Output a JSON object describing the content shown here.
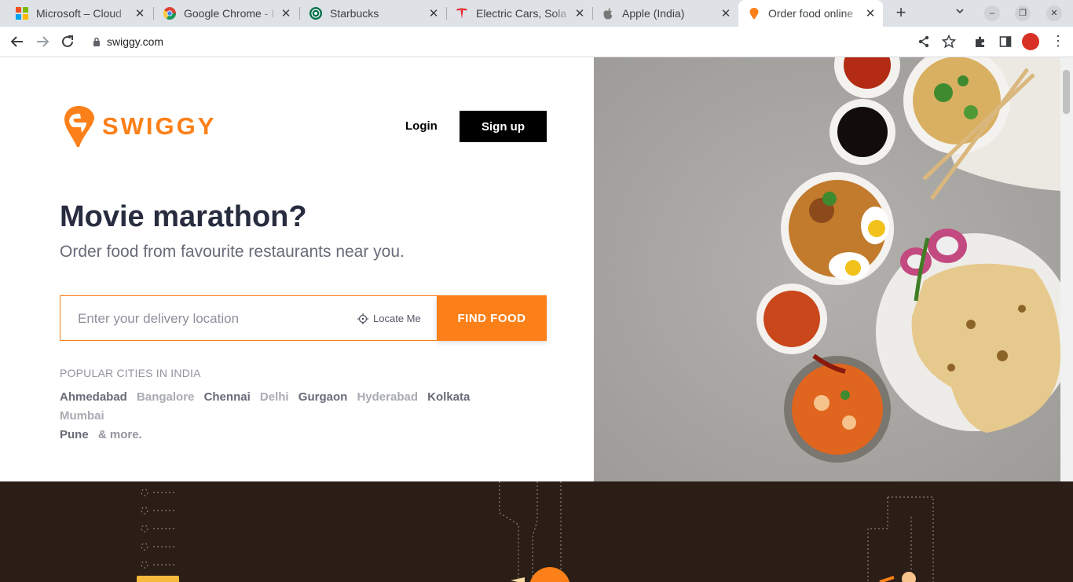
{
  "browser": {
    "tabs": [
      {
        "title": "Microsoft – Cloud",
        "icon": "microsoft-icon",
        "active": false
      },
      {
        "title": "Google Chrome - I",
        "icon": "chrome-icon",
        "active": false
      },
      {
        "title": "Starbucks",
        "icon": "starbucks-icon",
        "active": false
      },
      {
        "title": "Electric Cars, Sola",
        "icon": "tesla-icon",
        "active": false
      },
      {
        "title": "Apple (India)",
        "icon": "apple-icon",
        "active": false
      },
      {
        "title": "Order food online",
        "icon": "swiggy-icon",
        "active": true
      }
    ],
    "url": "swiggy.com"
  },
  "header": {
    "logo_text": "SWIGGY",
    "login_label": "Login",
    "signup_label": "Sign up"
  },
  "hero": {
    "headline": "Movie marathon?",
    "subline": "Order food from favourite restaurants near you."
  },
  "search": {
    "placeholder": "Enter your delivery location",
    "locate_label": "Locate Me",
    "button_label": "FIND FOOD"
  },
  "popular": {
    "title": "POPULAR CITIES IN INDIA",
    "cities": [
      "Ahmedabad",
      "Bangalore",
      "Chennai",
      "Delhi",
      "Gurgaon",
      "Hyderabad",
      "Kolkata",
      "Mumbai",
      "Pune"
    ],
    "more_label": "& more."
  },
  "colors": {
    "brand": "#fc8019",
    "footer_bg": "#2b1e16",
    "dark_text": "#282c3f"
  }
}
